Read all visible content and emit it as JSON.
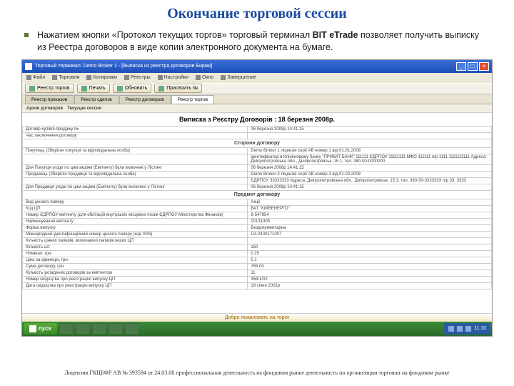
{
  "title": "Окончание торговой сессии",
  "bullet": {
    "pre": "Нажатием кнопки «Протокол текущих торгов» торговый терминал ",
    "brand": "BIT eTrade",
    "post": " позволяет получить выписку из Реестра договоров в виде копии электронного документа на бумаге."
  },
  "window": {
    "title": "Торговый терминал.  Demo Broker 1 - [Выписка из реестра договоров Биржи]",
    "menu": [
      "Файл",
      "Торговля",
      "Котировки",
      "Реестры",
      "Настройки",
      "Окно",
      "Завершение"
    ],
    "toolbar": {
      "b1": "Реестр торгов",
      "b2": "Печать",
      "b3": "Обновить",
      "b4": "Присвоить №"
    },
    "tabs": [
      "Реестр приказов",
      "Реестр сделок",
      "Реестр договоров",
      "Реестр торгов"
    ],
    "subbar": {
      "a": "Архив договоров",
      "b": "Текущая сессия"
    }
  },
  "doc": {
    "heading": "Виписка з Реєстру Договорів :  18 березня 2008р.",
    "section1": "Сторони договору",
    "section2": "Предмет договору",
    "rows1": [
      {
        "l": "Договір купівлі-продажу №",
        "r": "06 березня 2008р 14:41:15"
      },
      {
        "l": "Час заключення договору",
        "r": ""
      },
      {
        "l": "Покупець (Зберігач покупця та відповідальна особа)",
        "r": "Demo Broker 1\nліцензія серії АВ номер 1 від 01.01.2008"
      },
      {
        "l": "",
        "r": "ідентифікатор в Клінінговому банку \"ПРИВАТ БАНК\" 111111\nЄДРПОУ 11111111\nМФО 111111\nп/р 1111 1111111111\nАдреса: Дніпропетровська обл., Дніпропетровськ, 15.1, тел. 380-00-0000000"
      },
      {
        "l": "Для Покупця угоди по цим акціям (Емітенту) були включені у Лістинг",
        "r": "06 березня 2008р 14:41:15"
      },
      {
        "l": "Продавець (Зберігач продавця та відповідальна особа)",
        "r": "Demo Broker 3\nліцензія серії АВ номер 3 від 01.03.2008"
      },
      {
        "l": "",
        "r": "ЄДРПОУ 33333333\nАдреса: Дніпропетровська обл., Дніпропетровськ, 15.3, тел. 380-30-3333333\nп/р 33. 3333"
      },
      {
        "l": "Для Продавця угоди по цим акціям (Емітенту) були включені у Лістинг",
        "r": "06 березня 2008р 14:41:15"
      }
    ],
    "rows2": [
      {
        "l": "Вид цінного паперу",
        "r": "Акції"
      },
      {
        "l": "Код ЦП",
        "r": "ВАТ \"КИЇВЕНЕРГО\""
      },
      {
        "l": "Номер ЄДРПОУ емітенту (для облігацій внутрішніх місцевих позик ЄДРПОУ Міністерства Фінансів)",
        "r": "9-547954"
      },
      {
        "l": "Найменування емітенту",
        "r": "00131305"
      },
      {
        "l": "Форма випуску",
        "r": "Бездокументарна"
      },
      {
        "l": "Міжнародний ідентифікаційний номер цінного паперу (код ISIN)",
        "r": "UA 0400171007"
      },
      {
        "l": "Кількість цінних паперів, включаючи паперів інших ЦП",
        "r": ""
      },
      {
        "l": "Кількість шт.",
        "r": "150"
      },
      {
        "l": "Номінал, грн.",
        "r": "0.25"
      },
      {
        "l": "Ціна за одиницю, грн.",
        "r": "5.1"
      },
      {
        "l": "Сума договору, грн.",
        "r": "765.00"
      },
      {
        "l": "Кількість укладених договорів за емітентом",
        "r": "11"
      },
      {
        "l": "Номер свідоцтва про реєстрацію випуску ЦП",
        "r": "356/1/02"
      },
      {
        "l": "Дата свідоцтва про реєстрацію випуску ЦП",
        "r": "19 січня 2002р"
      }
    ]
  },
  "welcome": "Добро пожаловать на торги",
  "taskbar": {
    "start": "пуск",
    "time": "11:10"
  },
  "footer": "Лицензия ГКЦБФР АВ № 393594 от 24.03.08 профессиональная деятельность на фондовом рынке деятельность по организации торговли на фондовом рынке"
}
